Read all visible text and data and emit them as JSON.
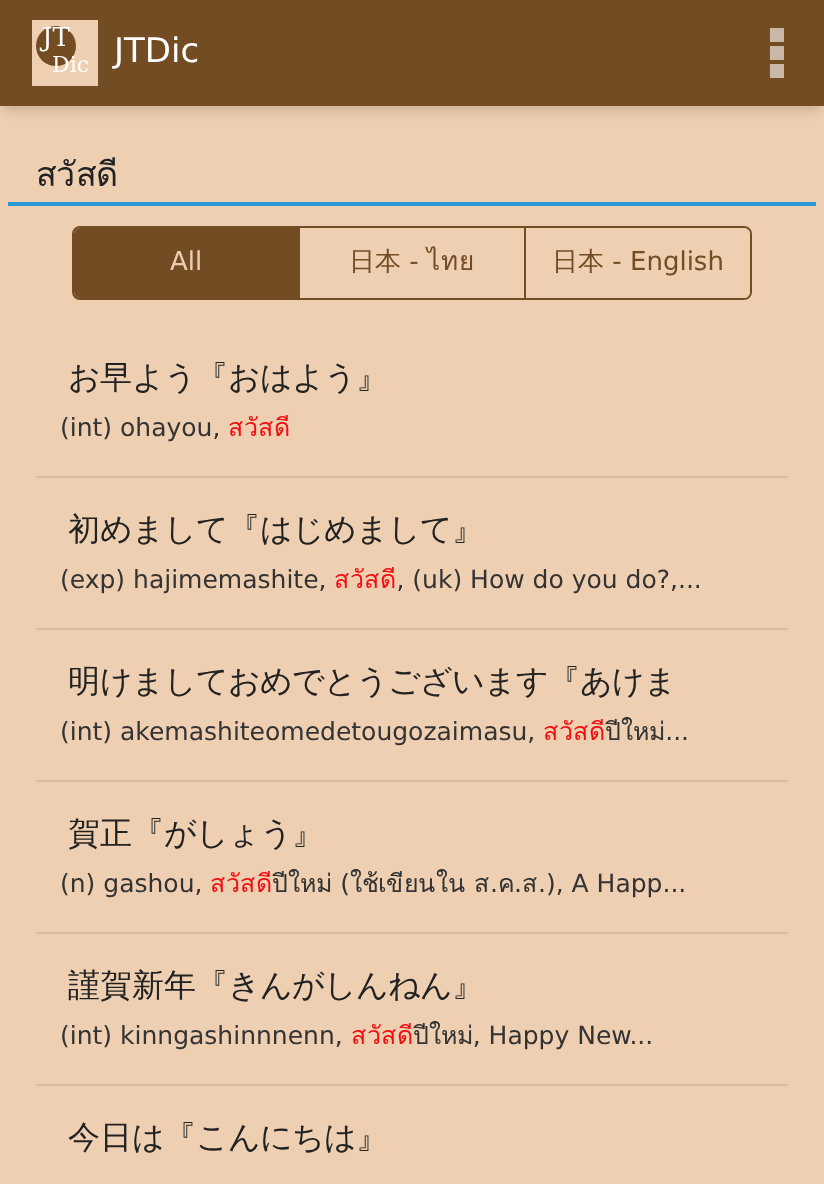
{
  "app_bar": {
    "logo": {
      "main": "JT",
      "sub": "Dic"
    },
    "title": "JTDic"
  },
  "search": {
    "value": "สวัสดี"
  },
  "tabs": [
    {
      "label": "All",
      "selected": true
    },
    {
      "label": "日本 - ไทย",
      "selected": false
    },
    {
      "label": "日本 - English",
      "selected": false
    }
  ],
  "results": [
    {
      "headword": "お早よう『おはよう』",
      "meaning": {
        "before": "(int) ohayou, ",
        "match": "สวัสดี"
      }
    },
    {
      "headword": "初めまして『はじめまして』",
      "meaning": {
        "before": "(exp) hajimemashite, ",
        "match": "สวัสดี",
        "after": ", (uk) How do you do?,..."
      }
    },
    {
      "headword": "明けましておめでとうございます『あけま",
      "meaning": {
        "before": "(int) akemashiteomedetougozaimasu, ",
        "match": "สวัสดี",
        "after": "ปีใหม่..."
      }
    },
    {
      "headword": "賀正『がしょう』",
      "meaning": {
        "before": "(n) gashou, ",
        "match": "สวัสดี",
        "after": "ปีใหม่ (ใช้เขียนใน ส.ค.ส.), A Happ..."
      }
    },
    {
      "headword": "謹賀新年『きんがしんねん』",
      "meaning": {
        "before": "(int) kinngashinnnenn, ",
        "match": "สวัสดี",
        "after": "ปีใหม่, Happy New..."
      }
    },
    {
      "headword": "今日は『こんにちは』"
    }
  ]
}
